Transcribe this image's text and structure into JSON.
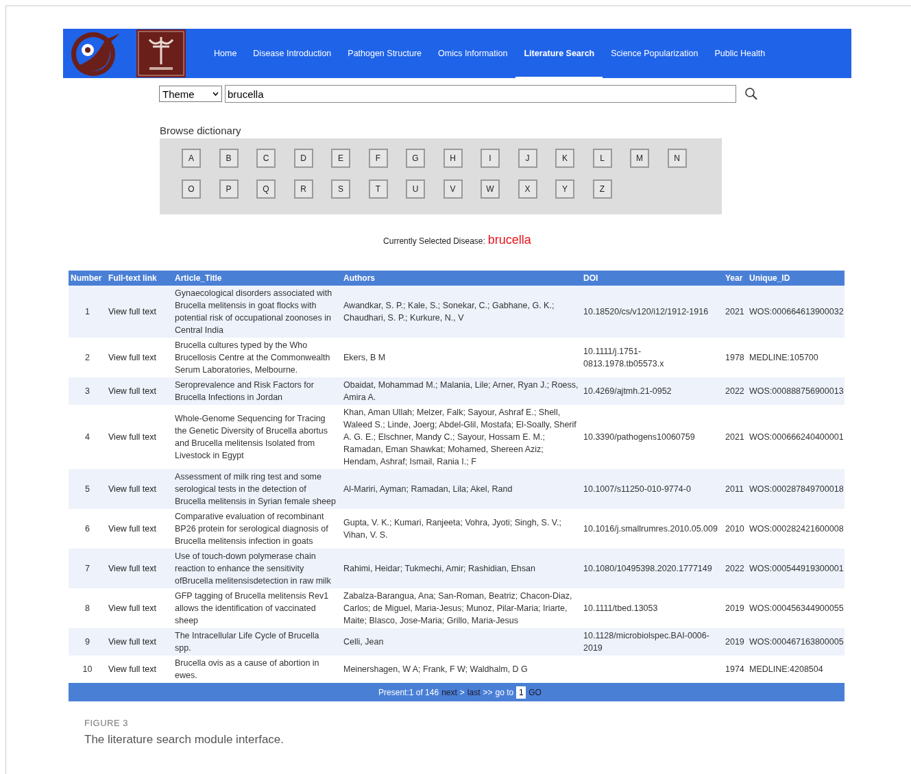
{
  "header": {
    "nav": [
      {
        "label": "Home",
        "selected": false
      },
      {
        "label": "Disease Introduction",
        "selected": false
      },
      {
        "label": "Pathogen Structure",
        "selected": false
      },
      {
        "label": "Omics Information",
        "selected": false
      },
      {
        "label": "Literature Search",
        "selected": true
      },
      {
        "label": "Science Popularization",
        "selected": false
      },
      {
        "label": "Public Health",
        "selected": false
      }
    ]
  },
  "search": {
    "field": "Theme",
    "query": "brucella"
  },
  "dictionary": {
    "title": "Browse dictionary",
    "letters": [
      "A",
      "B",
      "C",
      "D",
      "E",
      "F",
      "G",
      "H",
      "I",
      "J",
      "K",
      "L",
      "M",
      "N",
      "O",
      "P",
      "Q",
      "R",
      "S",
      "T",
      "U",
      "V",
      "W",
      "X",
      "Y",
      "Z"
    ]
  },
  "selected_disease": {
    "label": "Currently Selected Disease:",
    "value": "brucella"
  },
  "table": {
    "columns": [
      "Number",
      "Full-text link",
      "Article_Title",
      "Authors",
      "DOI",
      "Year",
      "Unique_ID"
    ],
    "rows": [
      {
        "number": "1",
        "link": "View full text",
        "title": "Gynaecological disorders associated with Brucella melitensis in goat flocks with potential risk of occupational zoonoses in Central India",
        "authors": "Awandkar, S. P.; Kale, S.; Sonekar, C.; Gabhane, G. K.; Chaudhari, S. P.; Kurkure, N., V",
        "doi": "10.18520/cs/v120/i12/1912-1916",
        "year": "2021",
        "id": "WOS:000664613900032"
      },
      {
        "number": "2",
        "link": "View full text",
        "title": "Brucella cultures typed by the Who Brucellosis Centre at the Commonwealth Serum Laboratories, Melbourne.",
        "authors": "Ekers, B M",
        "doi": "10.1111/j.1751-0813.1978.tb05573.x",
        "year": "1978",
        "id": "MEDLINE:105700"
      },
      {
        "number": "3",
        "link": "View full text",
        "title": "Seroprevalence and Risk Factors for Brucella Infections in Jordan",
        "authors": "Obaidat, Mohammad M.; Malania, Lile; Arner, Ryan J.; Roess, Amira A.",
        "doi": "10.4269/ajtmh.21-0952",
        "year": "2022",
        "id": "WOS:000888756900013"
      },
      {
        "number": "4",
        "link": "View full text",
        "title": "Whole-Genome Sequencing for Tracing the Genetic Diversity of Brucella abortus and Brucella melitensis Isolated from Livestock in Egypt",
        "authors": "Khan, Aman Ullah; Melzer, Falk; Sayour, Ashraf E.; Shell, Waleed S.; Linde, Joerg; Abdel-Glil, Mostafa; El-Soally, Sherif A. G. E.; Elschner, Mandy C.; Sayour, Hossam E. M.; Ramadan, Eman Shawkat; Mohamed, Shereen Aziz; Hendam, Ashraf; Ismail, Rania I.; F",
        "doi": "10.3390/pathogens10060759",
        "year": "2021",
        "id": "WOS:000666240400001"
      },
      {
        "number": "5",
        "link": "View full text",
        "title": "Assessment of milk ring test and some serological tests in the detection of Brucella melitensis in Syrian female sheep",
        "authors": "Al-Mariri, Ayman; Ramadan, Lila; Akel, Rand",
        "doi": "10.1007/s11250-010-9774-0",
        "year": "2011",
        "id": "WOS:000287849700018"
      },
      {
        "number": "6",
        "link": "View full text",
        "title": "Comparative evaluation of recombinant BP26 protein for serological diagnosis of Brucella melitensis infection in goats",
        "authors": "Gupta, V. K.; Kumari, Ranjeeta; Vohra, Jyoti; Singh, S. V.; Vihan, V. S.",
        "doi": "10.1016/j.smallrumres.2010.05.009",
        "year": "2010",
        "id": "WOS:000282421600008"
      },
      {
        "number": "7",
        "link": "View full text",
        "title": "Use of touch-down polymerase chain reaction to enhance the sensitivity ofBrucella melitensisdetection in raw milk",
        "authors": "Rahimi, Heidar; Tukmechi, Amir; Rashidian, Ehsan",
        "doi": "10.1080/10495398.2020.1777149",
        "year": "2022",
        "id": "WOS:000544919300001"
      },
      {
        "number": "8",
        "link": "View full text",
        "title": "GFP tagging of Brucella melitensis Rev1 allows the identification of vaccinated sheep",
        "authors": "Zabalza-Barangua, Ana; San-Roman, Beatriz; Chacon-Diaz, Carlos; de Miguel, Maria-Jesus; Munoz, Pilar-Maria; Iriarte, Maite; Blasco, Jose-Maria; Grillo, Maria-Jesus",
        "doi": "10.1111/tbed.13053",
        "year": "2019",
        "id": "WOS:000456344900055"
      },
      {
        "number": "9",
        "link": "View full text",
        "title": "The Intracellular Life Cycle of Brucella spp.",
        "authors": "Celli, Jean",
        "doi": "10.1128/microbiolspec.BAI-0006-2019",
        "year": "2019",
        "id": "WOS:000467163800005"
      },
      {
        "number": "10",
        "link": "View full text",
        "title": "Brucella ovis as a cause of abortion in ewes.",
        "authors": "Meinershagen, W A; Frank, F W; Waldhalm, D G",
        "year": "1974",
        "id": "MEDLINE:4208504"
      }
    ]
  },
  "pagination": {
    "info": "Present:1 of 146",
    "next": "next",
    "sep1": ">",
    "last": "last",
    "sep2": ">>",
    "goto": "go to",
    "page": "1",
    "go": "GO"
  },
  "caption": {
    "label": "FIGURE 3",
    "text": "The literature search module interface."
  }
}
